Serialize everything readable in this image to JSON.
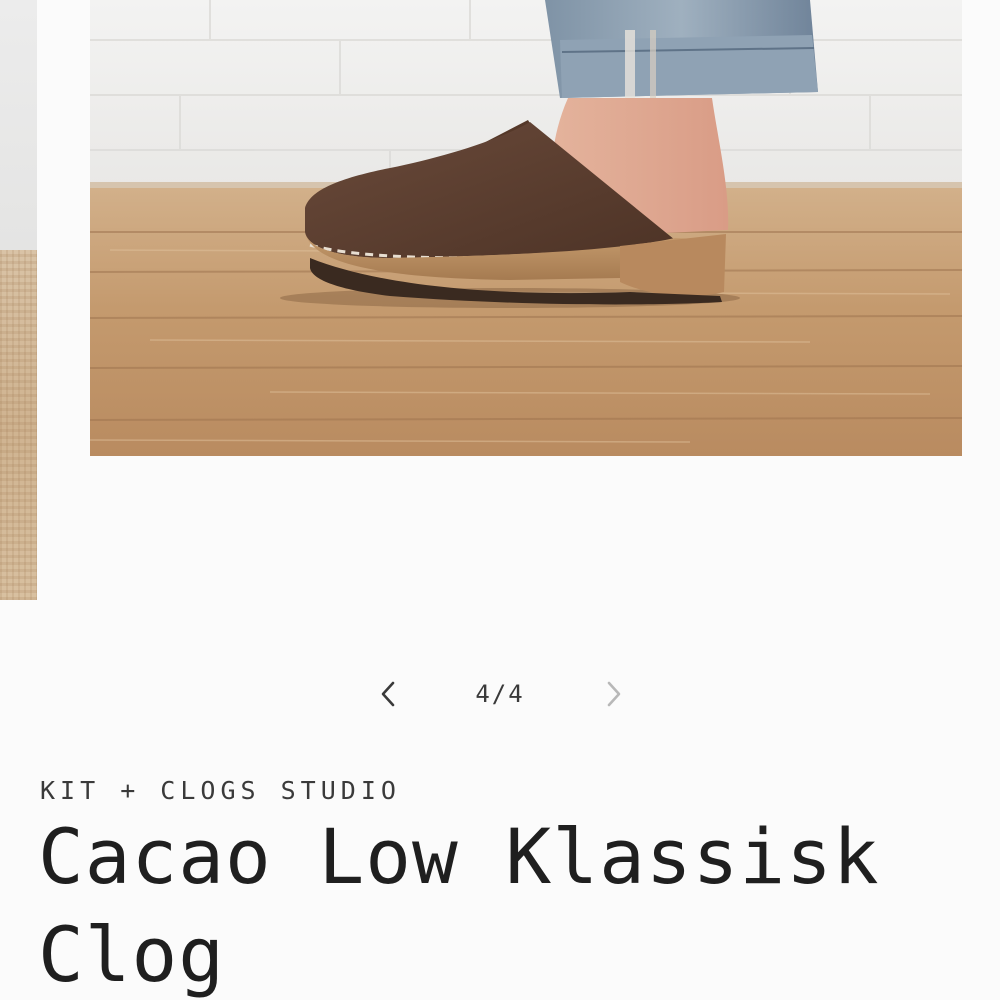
{
  "gallery": {
    "image_alt": "Cacao Low Klassisk Clog worn with cuffed jeans on a wooden floor",
    "counter": {
      "current": "4",
      "separator": "/",
      "total": "4"
    },
    "prev_icon": "chevron-left-icon",
    "next_icon": "chevron-right-icon"
  },
  "product": {
    "vendor": "KIT + CLOGS STUDIO",
    "title": "Cacao Low Klassisk Clog"
  },
  "colors": {
    "text_primary": "#1f1f1f",
    "text_secondary": "#3a3a3a",
    "arrow_active": "#3a3a3a",
    "arrow_disabled": "#b8b8b8",
    "background": "#fbfbfb"
  }
}
